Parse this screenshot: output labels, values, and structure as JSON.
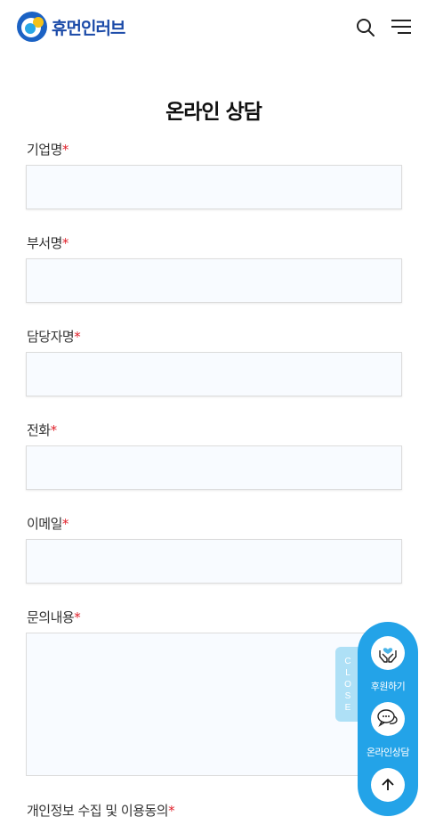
{
  "header": {
    "logo_text": "휴먼인러브",
    "icons": {
      "search": "search-icon",
      "menu": "hamburger-menu-icon"
    }
  },
  "page": {
    "title": "온라인 상담"
  },
  "form": {
    "required_mark": "*",
    "fields": [
      {
        "label": "기업명",
        "value": ""
      },
      {
        "label": "부서명",
        "value": ""
      },
      {
        "label": "담당자명",
        "value": ""
      },
      {
        "label": "전화",
        "value": ""
      },
      {
        "label": "이메일",
        "value": ""
      },
      {
        "label": "문의내용",
        "value": ""
      }
    ],
    "privacy_label": "개인정보 수집 및 이용동의"
  },
  "quick_menu": {
    "close_label": "CLOSE",
    "donate_label": "후원하기",
    "consult_label": "온라인상담",
    "icons": {
      "donate": "heart-hands-icon",
      "consult": "chat-bubbles-icon",
      "top": "arrow-up-icon"
    }
  },
  "colors": {
    "brand_blue": "#1b4aa8",
    "accent_blue": "#23a3e8",
    "required_red": "#e0202a",
    "close_tab": "#aee0f6"
  }
}
